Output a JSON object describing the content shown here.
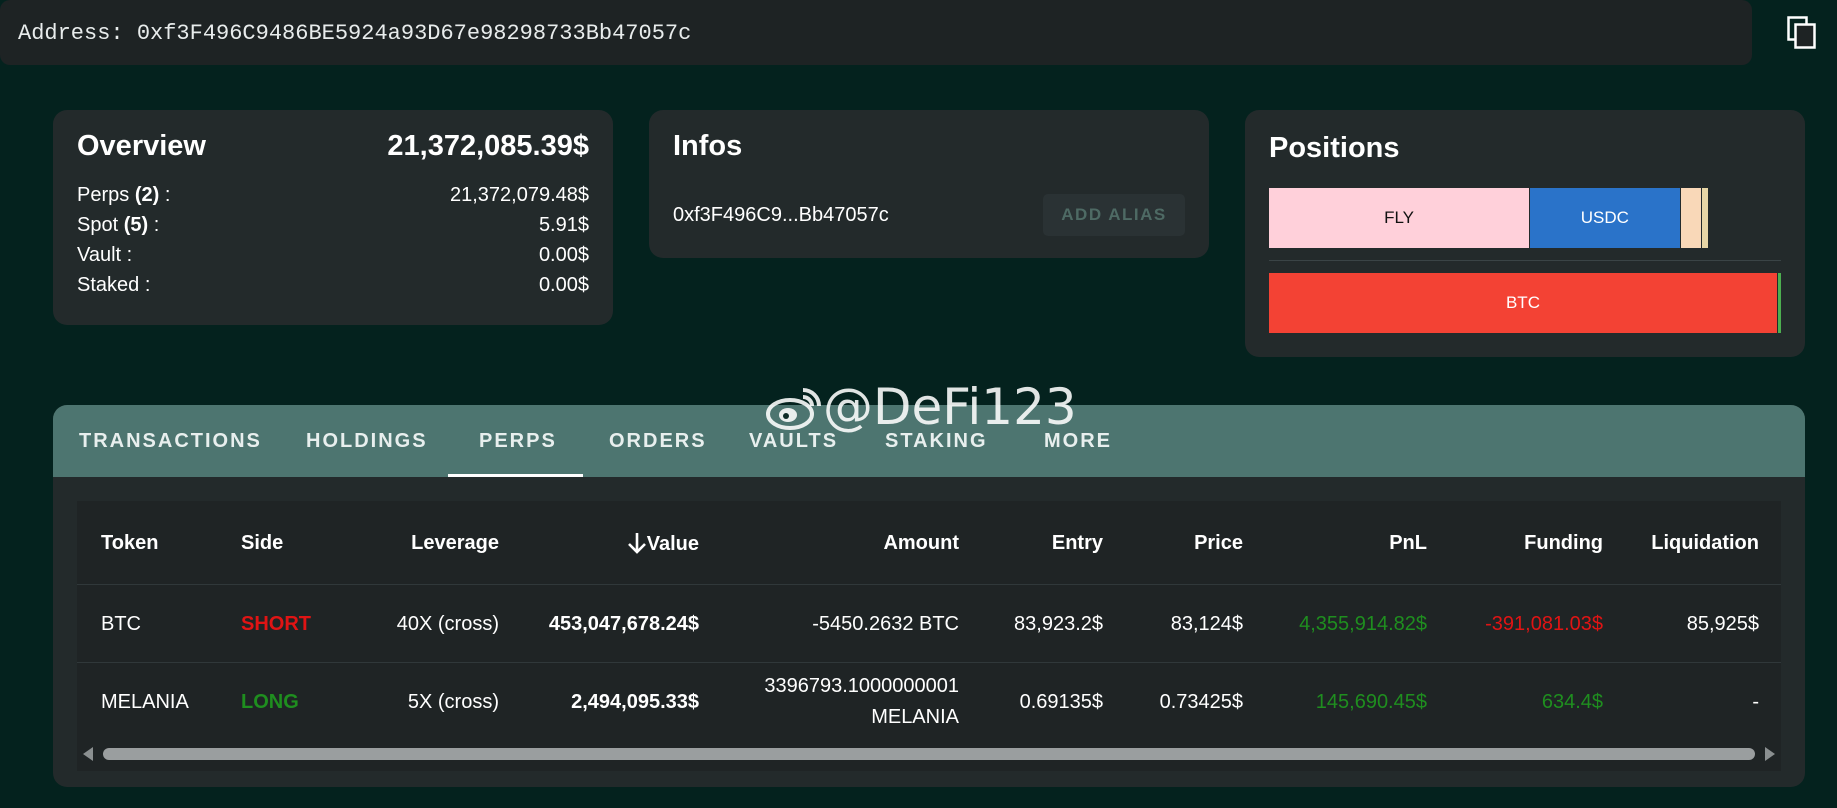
{
  "address": {
    "label": "Address: 0xf3F496C9486BE5924a93D67e98298733Bb47057c"
  },
  "overview": {
    "title": "Overview",
    "total": "21,372,085.39$",
    "rows": [
      {
        "name": "Perps",
        "count": "(2)",
        "suffix": " :",
        "value": "21,372,079.48$"
      },
      {
        "name": "Spot",
        "count": "(5)",
        "suffix": " :",
        "value": "5.91$"
      },
      {
        "name": "Vault :",
        "count": "",
        "suffix": "",
        "value": "0.00$"
      },
      {
        "name": "Staked :",
        "count": "",
        "suffix": "",
        "value": "0.00$"
      }
    ]
  },
  "infos": {
    "title": "Infos",
    "short_address": "0xf3F496C9...Bb47057c",
    "add_alias_label": "ADD ALIAS"
  },
  "positions": {
    "title": "Positions",
    "bar1": [
      {
        "label": "FLY",
        "share": 0.508,
        "color": "#ffd0da",
        "text_color": "#111111"
      },
      {
        "label": "USDC",
        "share": 0.292,
        "color": "#2a73c9",
        "text_color": "#ffffff"
      },
      {
        "label": "",
        "share": 0.04,
        "color": "#f9d8b8",
        "text_color": "#111111"
      },
      {
        "label": "",
        "share": 0.012,
        "color": "#e7d6a6",
        "text_color": "#111111"
      }
    ],
    "bar2": [
      {
        "label": "BTC",
        "share": 0.994,
        "color": "#f34234",
        "text_color": "#ffffff"
      },
      {
        "label": "",
        "share": 0.006,
        "color": "#4caf50",
        "text_color": "#ffffff"
      }
    ]
  },
  "tabs": {
    "items": [
      "TRANSACTIONS",
      "HOLDINGS",
      "PERPS",
      "ORDERS",
      "VAULTS",
      "STAKING",
      "MORE"
    ],
    "active": "PERPS"
  },
  "table": {
    "columns": [
      "Token",
      "Side",
      "Leverage",
      "Value",
      "Amount",
      "Entry",
      "Price",
      "PnL",
      "Funding",
      "Liquidation"
    ],
    "rows": [
      {
        "token": "BTC",
        "side": "SHORT",
        "leverage": "40X (cross)",
        "value": "453,047,678.24$",
        "amount": [
          "-5450.2632 BTC"
        ],
        "entry": "83,923.2$",
        "price": "83,124$",
        "pnl": "4,355,914.82$",
        "funding": "-391,081.03$",
        "liquidation": "85,925$"
      },
      {
        "token": "MELANIA",
        "side": "LONG",
        "leverage": "5X (cross)",
        "value": "2,494,095.33$",
        "amount": [
          "3396793.1000000001",
          "MELANIA"
        ],
        "entry": "0.69135$",
        "price": "0.73425$",
        "pnl": "145,690.45$",
        "funding": "634.4$",
        "liquidation": "-"
      }
    ]
  },
  "watermark": {
    "text": "@DeFi123"
  },
  "colors": {
    "positive": "#1f8e1f",
    "negative": "#e01414",
    "tab_bar": "#4d7570",
    "card": "#232a2b"
  }
}
